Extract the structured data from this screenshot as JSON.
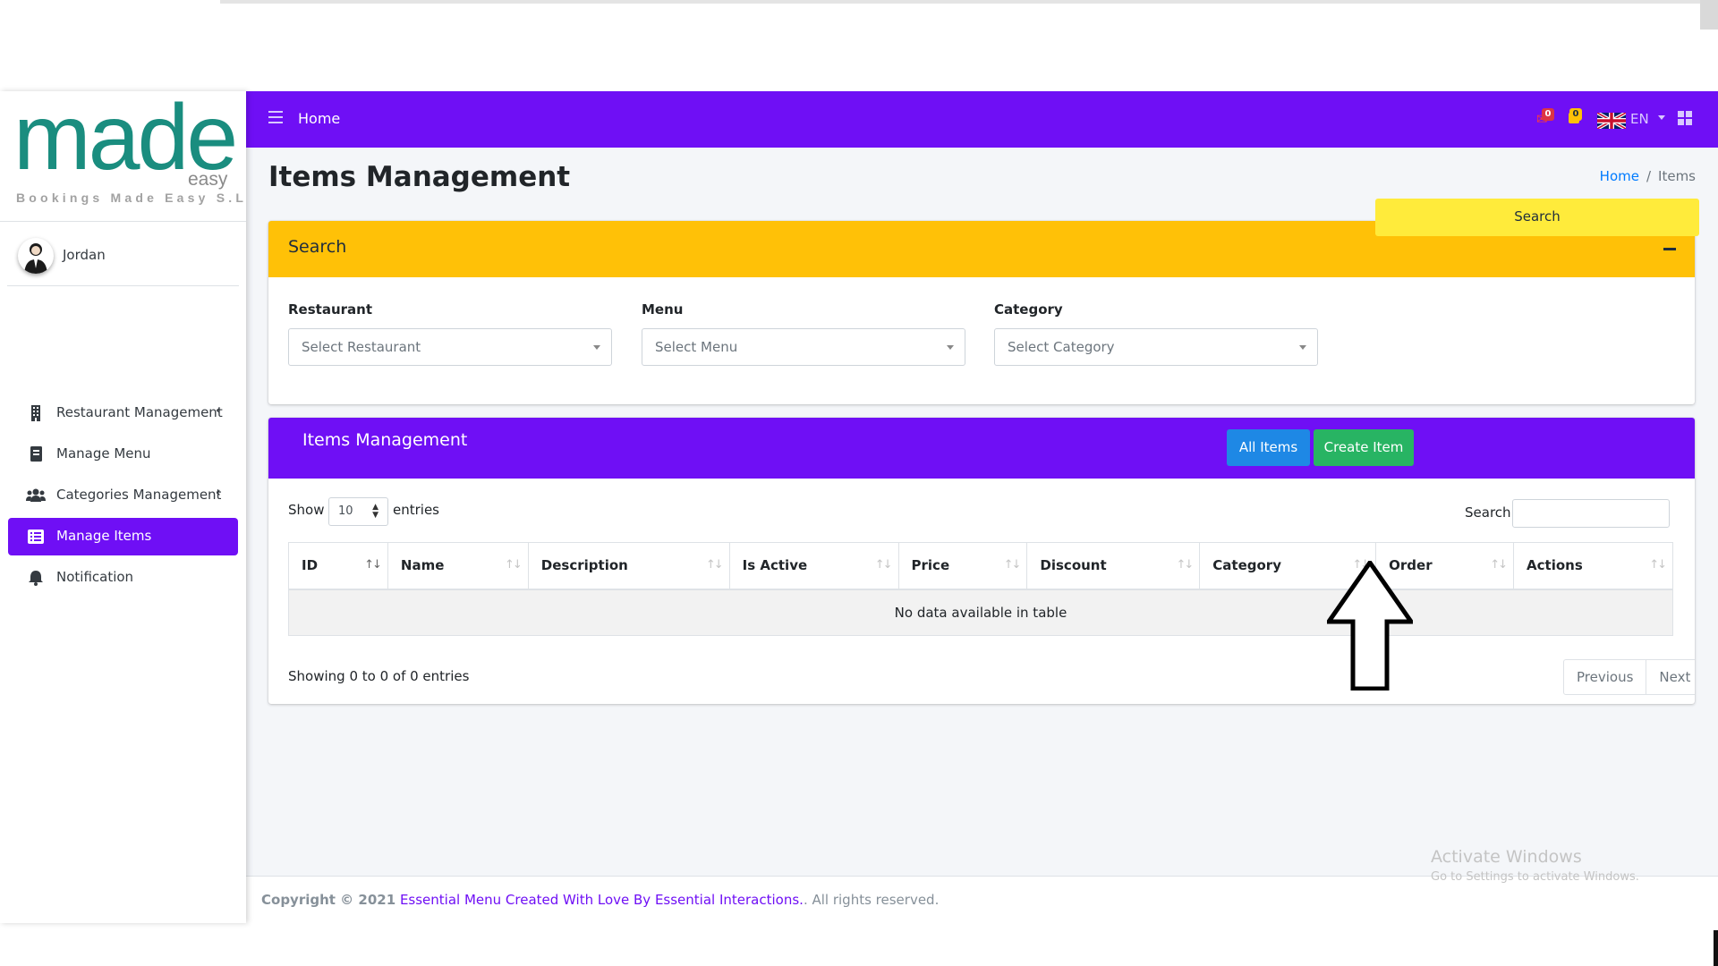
{
  "app": {
    "logo": {
      "wordmark": "made",
      "sub": "easy",
      "tagline": "Bookings Made Easy S.L"
    },
    "user": {
      "name": "Jordan"
    }
  },
  "sidebar": {
    "items": [
      {
        "label": "Restaurant Management",
        "icon": "building-icon",
        "has_chevron": true,
        "active": false
      },
      {
        "label": "Manage Menu",
        "icon": "book-icon",
        "has_chevron": false,
        "active": false
      },
      {
        "label": "Categories Management",
        "icon": "users-icon",
        "has_chevron": true,
        "active": false
      },
      {
        "label": "Manage Items",
        "icon": "list-icon",
        "has_chevron": false,
        "active": true
      },
      {
        "label": "Notification",
        "icon": "bell-icon",
        "has_chevron": false,
        "active": false
      }
    ],
    "chevron": "‹"
  },
  "navbar": {
    "home_label": "Home",
    "messages_count": "0",
    "notifications_count": "0",
    "language": "EN"
  },
  "page": {
    "title": "Items Management",
    "breadcrumb": {
      "home": "Home",
      "separator": "/",
      "current": "Items"
    }
  },
  "search_card": {
    "title": "Search",
    "restaurant_label": "Restaurant",
    "restaurant_placeholder": "Select Restaurant",
    "menu_label": "Menu",
    "menu_placeholder": "Select Menu",
    "category_label": "Category",
    "category_placeholder": "Select Category",
    "search_button": "Search"
  },
  "items_card": {
    "title": "Items Management",
    "all_items_button": "All Items",
    "create_item_button": "Create Item",
    "show_label": "Show",
    "entries_value": "10",
    "entries_label": "entries",
    "search_label": "Search:",
    "columns": [
      "ID",
      "Name",
      "Description",
      "Is Active",
      "Price",
      "Discount",
      "Category",
      "Order",
      "Actions"
    ],
    "empty_message": "No data available in table",
    "info": "Showing 0 to 0 of 0 entries",
    "previous": "Previous",
    "next": "Next"
  },
  "footer": {
    "prefix": "Copyright © 2021",
    "link_text": "Essential Menu Created With Love By Essential Interactions.",
    "suffix": ". All rights reserved."
  },
  "watermark": {
    "title": "Activate Windows",
    "subtitle": "Go to Settings to activate Windows."
  },
  "colors": {
    "brand": "#6f0ff5",
    "search_header": "#ffc107",
    "search_button": "#ffeb3b",
    "all_items": "#1e88e5",
    "create_item": "#28b463",
    "logo": "#1a8d7f"
  }
}
